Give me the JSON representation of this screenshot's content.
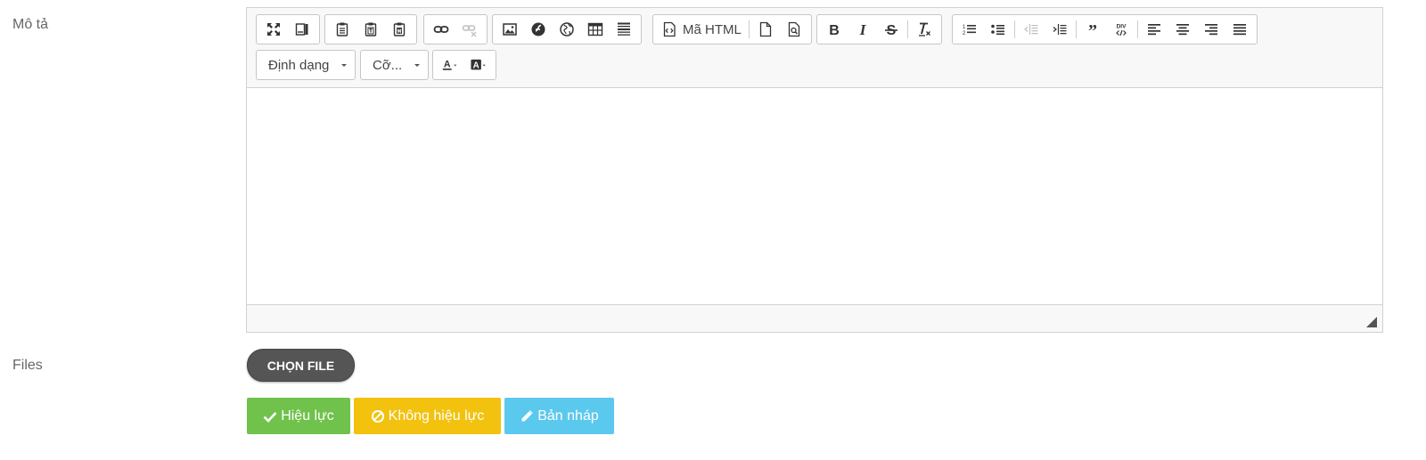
{
  "form": {
    "description_label": "Mô tả",
    "files_label": "Files"
  },
  "editor": {
    "source_label": "Mã HTML",
    "format_label": "Định dạng",
    "size_label": "Cỡ..."
  },
  "files": {
    "choose_label": "CHỌN FILE"
  },
  "actions": {
    "valid_label": "Hiệu lực",
    "invalid_label": "Không hiệu lực",
    "draft_label": "Bản nháp"
  },
  "colors": {
    "valid": "#71c24c",
    "invalid": "#f2c20f",
    "draft": "#5bc8ee",
    "file_button": "#555555"
  }
}
